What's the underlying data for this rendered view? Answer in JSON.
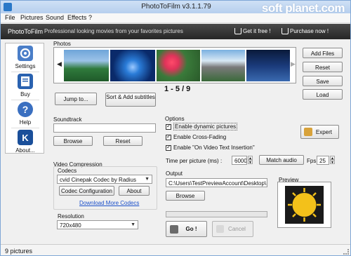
{
  "window": {
    "title": "PhotoToFilm v3.1.1.79"
  },
  "watermark": {
    "text": "soft planet.com"
  },
  "menu": [
    {
      "label": "File"
    },
    {
      "label": "Pictures"
    },
    {
      "label": "Sound"
    },
    {
      "label": "Effects"
    },
    {
      "label": "?"
    }
  ],
  "banner": {
    "title": "PhotoToFilm",
    "subtitle": "Professional looking movies from your favorites pictures",
    "get_it_free": "Get it free !",
    "purchase_now": "Purchase now !"
  },
  "sidebar": {
    "items": [
      {
        "label": "Settings",
        "icon": "gear-icon",
        "color": "#4a7ec8"
      },
      {
        "label": "Buy",
        "icon": "book-icon",
        "color": "#2a62b0"
      },
      {
        "label": "Help",
        "icon": "help-icon",
        "color": "#3a6fc0"
      },
      {
        "label": "About...",
        "icon": "about-icon",
        "color": "#1a4f9a"
      }
    ]
  },
  "photos": {
    "label": "Photos",
    "counter": "1 - 5 / 9",
    "buttons": {
      "jump_to": "Jump to...",
      "sort_add_subtitles": "Sort & Add subtitles",
      "add_files": "Add Files",
      "reset": "Reset",
      "save": "Save",
      "load": "Load"
    }
  },
  "soundtrack": {
    "label": "Soundtrack",
    "value": "",
    "browse": "Browse",
    "reset": "Reset"
  },
  "video_compression": {
    "label": "Video Compression",
    "codecs_label": "Codecs",
    "codec_value": "cvid Cinepak Codec by Radius",
    "codec_configuration": "Codec Configuration",
    "about": "About",
    "download_more": "Download More Codecs"
  },
  "resolution": {
    "label": "Resolution",
    "value": "720x480"
  },
  "options": {
    "label": "Options",
    "enable_dynamic_pictures": "Enable dynamic pictures",
    "enable_cross_fading": "Enable Cross-Fading",
    "enable_on_video_text": "Enable \"On Video Text Insertion\"",
    "expert": "Expert",
    "time_per_picture_label": "Time per picture (ms) :",
    "time_per_picture_value": "6000",
    "match_audio": "Match audio",
    "fps_label": "Fps :",
    "fps_value": "25"
  },
  "output": {
    "label": "Output",
    "path_value": "C:\\Users\\TestPreviewAccount\\Desktop\\132.a",
    "browse": "Browse",
    "progress": 0,
    "go": "Go !",
    "cancel": "Cancel"
  },
  "preview": {
    "label": "Preview"
  },
  "status": {
    "text": "9 pictures"
  }
}
